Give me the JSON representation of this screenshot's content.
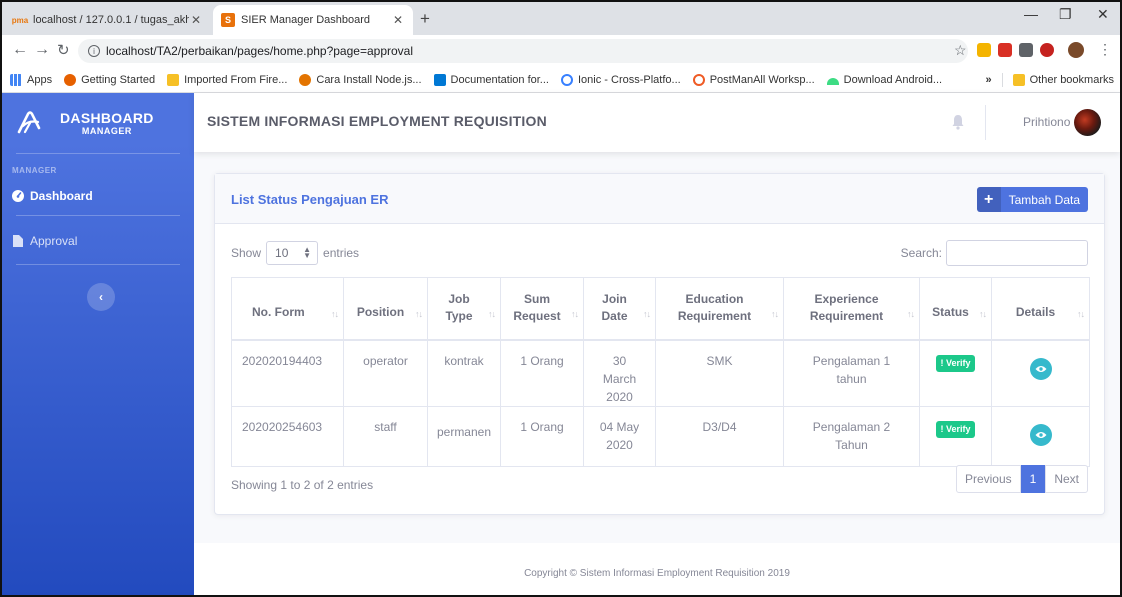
{
  "browser": {
    "tabs": [
      {
        "title": "localhost / 127.0.0.1 / tugas_akhi",
        "favicon": "phpmyadmin-icon",
        "active": false
      },
      {
        "title": "SIER Manager Dashboard",
        "favicon": "sier-icon",
        "active": true
      }
    ],
    "url": "localhost/TA2/perbaikan/pages/home.php?page=approval",
    "bookmarks": [
      {
        "label": "Apps",
        "icon": "apps-grid-icon"
      },
      {
        "label": "Getting Started",
        "icon": "firefox-icon"
      },
      {
        "label": "Imported From Fire...",
        "icon": "folder-icon"
      },
      {
        "label": "Cara Install Node.js...",
        "icon": "site-icon"
      },
      {
        "label": "Documentation for...",
        "icon": "vscode-icon"
      },
      {
        "label": "Ionic - Cross-Platfo...",
        "icon": "ionic-icon"
      },
      {
        "label": "PostManAll Worksp...",
        "icon": "postman-icon"
      },
      {
        "label": "Download Android...",
        "icon": "android-icon"
      }
    ],
    "overflow": "»",
    "other_bookmarks": "Other bookmarks"
  },
  "sidebar": {
    "brand_line1": "DASHBOARD",
    "brand_line2": "MANAGER",
    "heading": "MANAGER",
    "items": [
      {
        "label": "Dashboard",
        "icon": "tachometer-icon",
        "active": true
      },
      {
        "label": "Approval",
        "icon": "file-icon",
        "active": false
      }
    ],
    "toggle": "‹"
  },
  "topbar": {
    "title": "SISTEM INFORMASI EMPLOYMENT REQUISITION",
    "user_name": "Prihtiono"
  },
  "card": {
    "title": "List Status Pengajuan ER",
    "add_button": "Tambah Data",
    "show_label": "Show",
    "entries_value": "10",
    "entries_label": "entries",
    "search_label": "Search:",
    "info": "Showing 1 to 2 of 2 entries",
    "pagination": {
      "previous": "Previous",
      "current": "1",
      "next": "Next"
    }
  },
  "table": {
    "columns": [
      "No. Form",
      "Position",
      "Job Type",
      "Sum Request",
      "Join Date",
      "Education Requirement",
      "Experience Requirement",
      "Status",
      "Details"
    ],
    "rows": [
      {
        "no_form": "202020194403",
        "position": "operator",
        "job_type": "kontrak",
        "sum_request": "1 Orang",
        "join_date": "30 March 2020",
        "education": "SMK",
        "experience": "Pengalaman 1 tahun",
        "status": "Verify"
      },
      {
        "no_form": "202020254603",
        "position": "staff",
        "job_type": "permanen",
        "sum_request": "1 Orang",
        "join_date": "04 May 2020",
        "education": "D3/D4",
        "experience": "Pengalaman 2 Tahun",
        "status": "Verify"
      }
    ]
  },
  "footer": {
    "copyright": "Copyright © Sistem Informasi Employment Requisition 2019"
  },
  "colors": {
    "primary": "#4e73df",
    "success": "#1cc88a",
    "info": "#36b9cc"
  }
}
